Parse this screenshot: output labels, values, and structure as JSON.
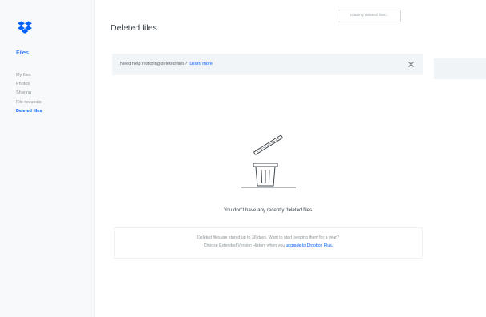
{
  "sidebar": {
    "section_title": "Files",
    "items": [
      {
        "label": "My files"
      },
      {
        "label": "Photos"
      },
      {
        "label": "Sharing"
      },
      {
        "label": "File requests"
      },
      {
        "label": "Deleted files"
      }
    ],
    "active_item": "Deleted files"
  },
  "page": {
    "title": "Deleted files",
    "loading_text": "Loading deleted files..."
  },
  "help_banner": {
    "text": "Need help restoring deleted files?",
    "link": "Learn more"
  },
  "empty_state": {
    "icon": "trash-can-icon",
    "message": "You don't have any recently deleted files"
  },
  "info": {
    "line1": "Deleted files are stored up to 30 days. Want to start keeping them for a year?",
    "line2_prefix": "Choose Extended Version History when you",
    "line2_link": "upgrade to Dropbox Plus."
  },
  "colors": {
    "accent": "#0061fe",
    "sidebar_bg": "#f7f9fa",
    "banner_bg": "#f2f5f8",
    "text": "#3d464d",
    "muted": "#8a9499"
  }
}
